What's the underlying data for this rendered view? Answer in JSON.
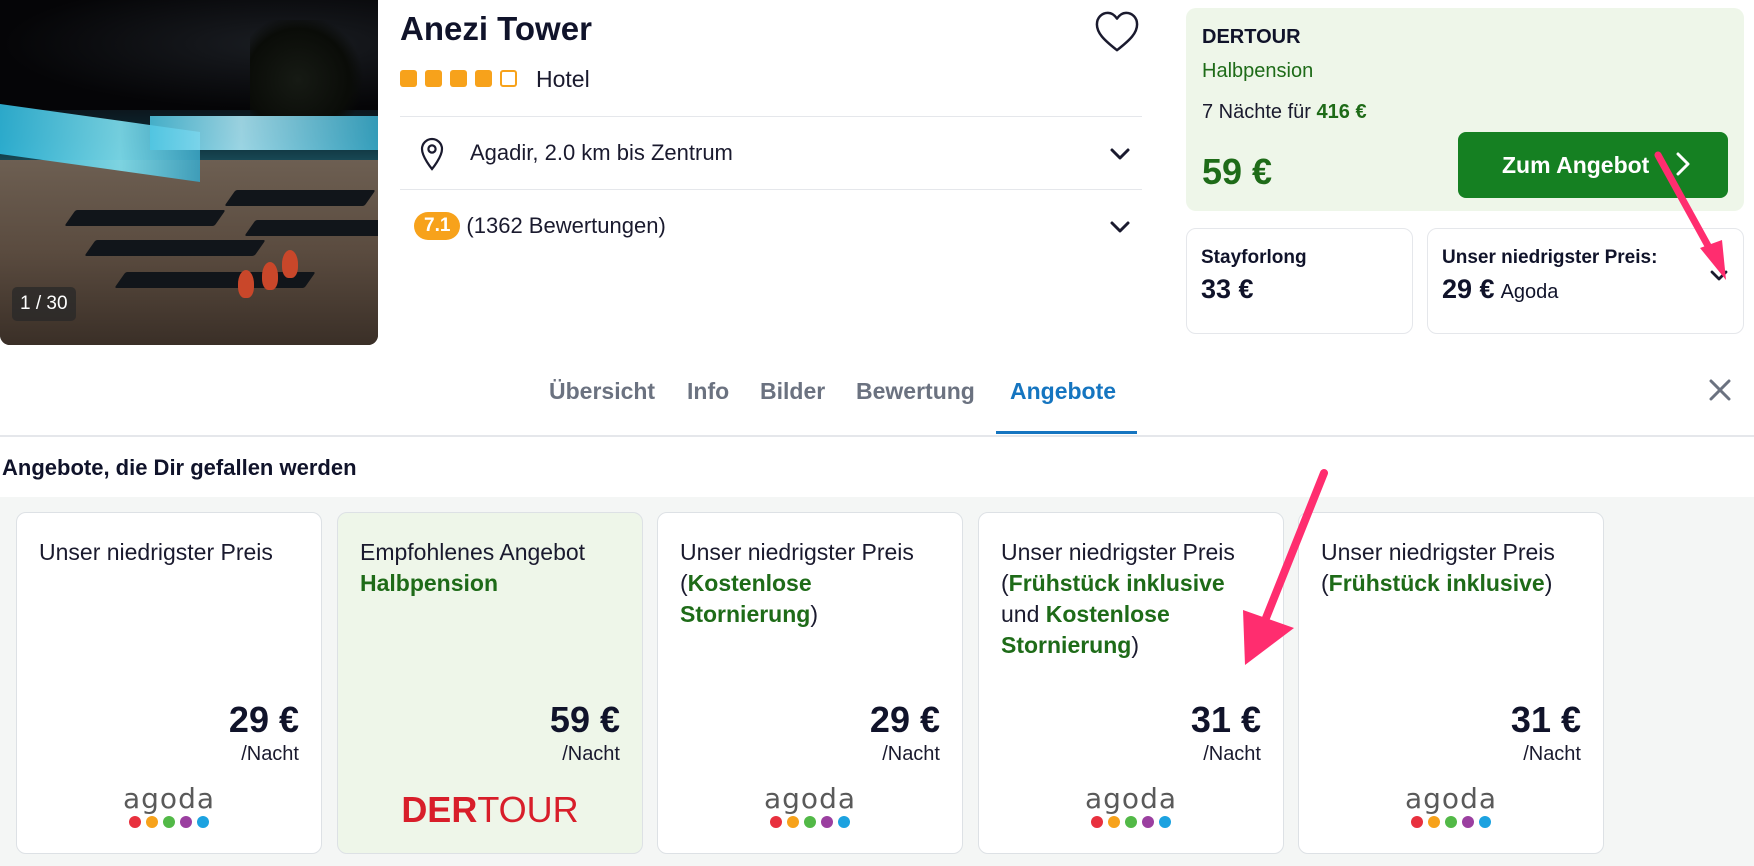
{
  "hotel": {
    "name": "Anezi Tower",
    "stars_filled": 4,
    "stars_total": 5,
    "type": "Hotel",
    "photo_counter": "1 / 30",
    "location": "Agadir, 2.0 km bis Zentrum",
    "rating": "7.1",
    "reviews": "(1362 Bewertungen)"
  },
  "offer": {
    "provider": "DERTOUR",
    "board": "Halbpension",
    "nights_prefix": "7 Nächte für ",
    "nights_total": "416 €",
    "price": "59 €",
    "button_label": "Zum Angebot"
  },
  "mini_offers": [
    {
      "label": "Stayforlong",
      "price": "33 €",
      "provider": ""
    },
    {
      "label": "Unser niedrigster Preis:",
      "price": "29 €",
      "provider": "Agoda"
    }
  ],
  "tabs": [
    "Übersicht",
    "Info",
    "Bilder",
    "Bewertung",
    "Angebote"
  ],
  "active_tab": "Angebote",
  "section_title": "Angebote, die Dir gefallen werden",
  "cards": [
    {
      "title": "Unser niedrigster Preis",
      "price": "29 €",
      "per": "/Nacht",
      "logo": "agoda"
    },
    {
      "title": "Empfohlenes Angebot",
      "highlight": "Halbpension",
      "price": "59 €",
      "per": "/Nacht",
      "logo": "DERTOUR"
    },
    {
      "title": "Unser niedrigster Preis",
      "open": "(",
      "highlight": "Kostenlose Stornierung",
      "close": ")",
      "price": "29 €",
      "per": "/Nacht",
      "logo": "agoda"
    },
    {
      "title": "Unser niedrigster Preis",
      "open": "(",
      "highlight": "Frühstück inklusive",
      "mid": "und",
      "highlight2": "Kostenlose Stornierung",
      "close": ")",
      "price": "31 €",
      "per": "/Nacht",
      "logo": "agoda"
    },
    {
      "title": "Unser niedrigster Preis",
      "open": "(",
      "highlight": "Frühstück inklusive",
      "close": ")",
      "price": "31 €",
      "per": "/Nacht",
      "logo": "agoda"
    }
  ],
  "colors": {
    "green": "#1e6b18",
    "button_green": "#158022",
    "orange": "#f7a21b",
    "blue": "#1575c0",
    "annotation_pink": "#ff2d6f",
    "agoda_dots": [
      "#e8303e",
      "#f7a21b",
      "#52b947",
      "#9b3fa0",
      "#1ca2e0"
    ]
  }
}
